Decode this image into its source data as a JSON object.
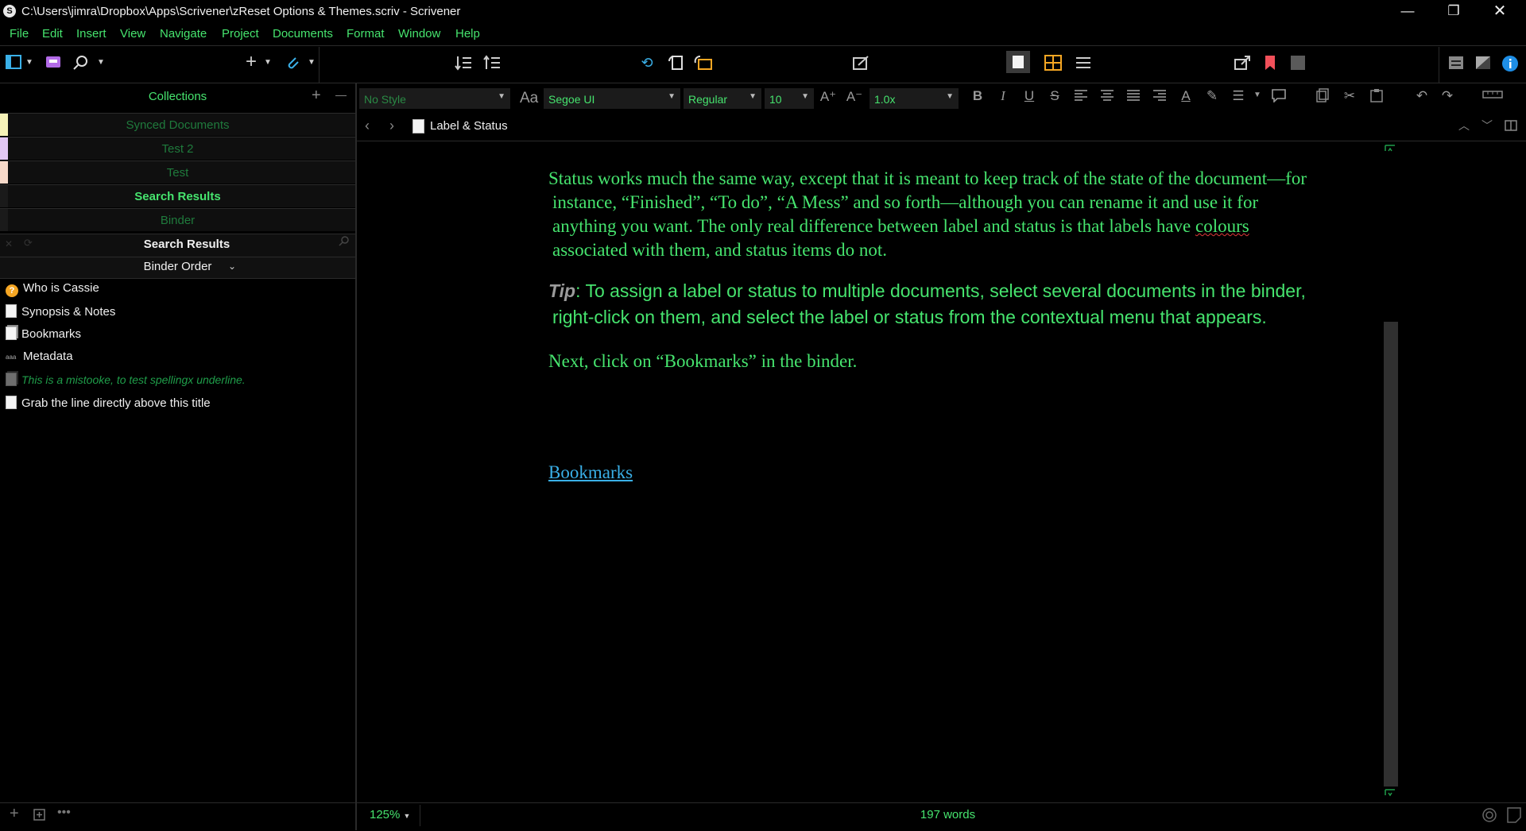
{
  "window": {
    "title": "C:\\Users\\jimra\\Dropbox\\Apps\\Scrivener\\zReset Options & Themes.scriv - Scrivener",
    "app_icon_letter": "S",
    "minimize": "—",
    "restore": "❐",
    "close": "✕"
  },
  "menu": [
    "File",
    "Edit",
    "Insert",
    "View",
    "Navigate",
    "Project",
    "Documents",
    "Format",
    "Window",
    "Help"
  ],
  "collections": {
    "title": "Collections",
    "add": "+",
    "remove": "—",
    "items": [
      {
        "label": "Synced Documents",
        "color": "#f6f2b8"
      },
      {
        "label": "Test 2",
        "color": "#e2c7f3"
      },
      {
        "label": "Test",
        "color": "#f7d9c9"
      },
      {
        "label": "Search Results",
        "color": "#1a1a1a"
      },
      {
        "label": "Binder",
        "color": "#1a1a1a"
      }
    ],
    "search_results_title": "Search Results",
    "sort_order": "Binder Order",
    "sort_arrow": "⌄"
  },
  "binder_items": [
    {
      "label": "Who is Cassie",
      "icon": "question-icon"
    },
    {
      "label": "Synopsis & Notes",
      "icon": "document-icon"
    },
    {
      "label": "Bookmarks",
      "icon": "document-stack-icon"
    },
    {
      "label": "Metadata",
      "icon": "aaa-icon"
    },
    {
      "label": "This is a mistooke, to test spellingx underline.",
      "icon": "document-stack-icon",
      "italic": true
    },
    {
      "label": "Grab the line directly above this title",
      "icon": "document-icon"
    }
  ],
  "format_bar": {
    "style": "No Style",
    "aa": "Aa",
    "font": "Segoe UI",
    "weight": "Regular",
    "size": "10",
    "line_spacing": "1.0x",
    "bold": "B",
    "italic": "I",
    "underline": "U",
    "strike": "S",
    "grow": "A⁺",
    "shrink": "A⁻"
  },
  "editor": {
    "doc_title": "Label & Status",
    "para1_a": "Status works much the same way, except that it is meant to keep track of the state of the document—for instance, “Finished”, “To do”, “A Mess” and so forth—although you can rename it and use it for anything you want. The only real difference between label and status is that labels have ",
    "para1_spell": "colours",
    "para1_b": " associated with them, and status items do not.",
    "tip_label": "Tip",
    "tip_text": ": To assign a label or status to multiple documents, select several documents in the binder, right-click on them, and select the label or status from the contextual menu that appears.",
    "para3": "Next, click on “Bookmarks” in the binder.",
    "link": "Bookmarks"
  },
  "footer": {
    "zoom": "125%",
    "word_count": "197 words"
  },
  "colors": {
    "accent_green": "#46e46e",
    "link_blue": "#3ab0e8",
    "bookmark_red": "#f2505a",
    "orange": "#f5a623"
  }
}
